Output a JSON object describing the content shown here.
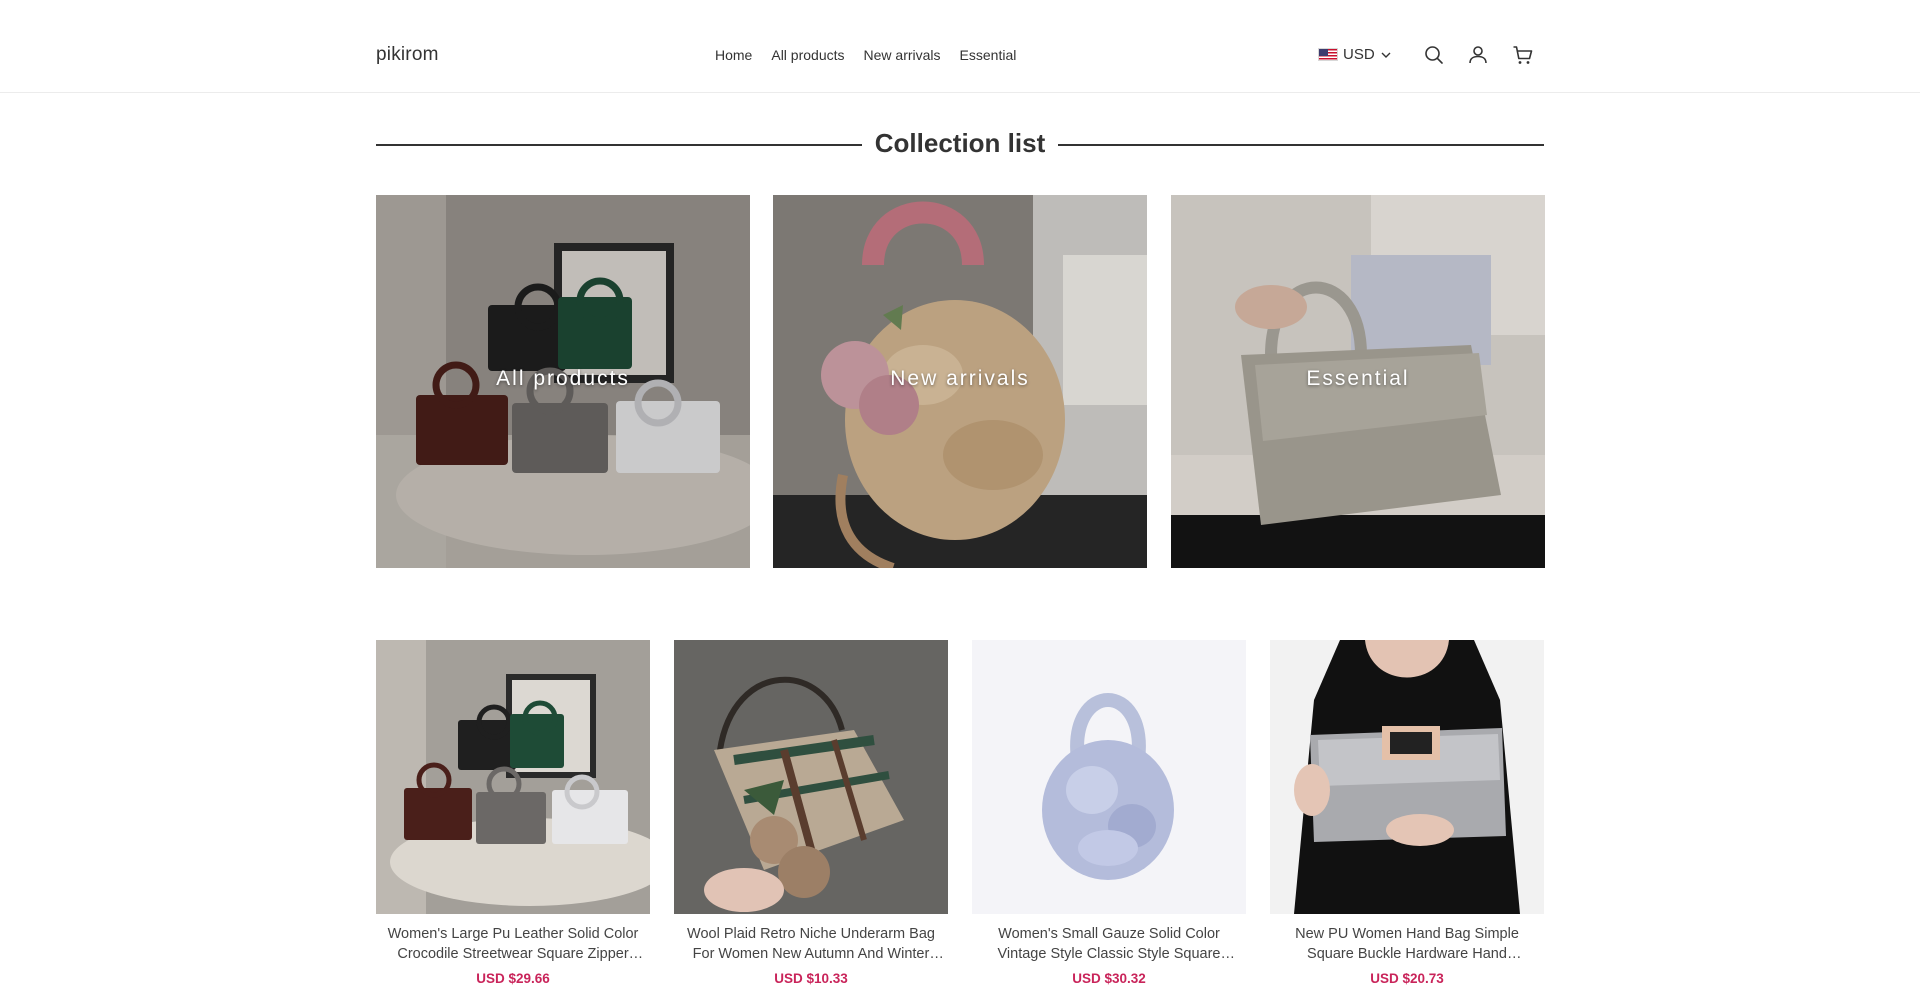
{
  "store": {
    "name": "pikirom"
  },
  "nav": {
    "items": [
      {
        "label": "Home"
      },
      {
        "label": "All products"
      },
      {
        "label": "New arrivals"
      },
      {
        "label": "Essential"
      }
    ]
  },
  "header": {
    "currency": "USD",
    "icons": [
      "us-flag-icon",
      "chevron-down-icon",
      "search-icon",
      "user-icon",
      "cart-icon"
    ]
  },
  "collections": {
    "title": "Collection list",
    "items": [
      {
        "label": "All products"
      },
      {
        "label": "New arrivals"
      },
      {
        "label": "Essential"
      }
    ]
  },
  "products": [
    {
      "title": "Women's Large Pu Leather Solid Color Crocodile Streetwear Square Zipper Handbag",
      "price": "USD $29.66"
    },
    {
      "title": "Wool Plaid Retro Niche Underarm Bag For Women New Autumn And Winter Cute Bag",
      "price": "USD $10.33"
    },
    {
      "title": "Women's Small Gauze Solid Color Vintage Style Classic Style Square Magnetic Buckle Bag",
      "price": "USD $30.32"
    },
    {
      "title": "New PU Women Hand Bag Simple Square Buckle Hardware Hand Crosbody Bag",
      "price": "USD $20.73"
    }
  ],
  "colors": {
    "price": "#c9245a",
    "text": "#333333",
    "divider": "#ececec"
  }
}
